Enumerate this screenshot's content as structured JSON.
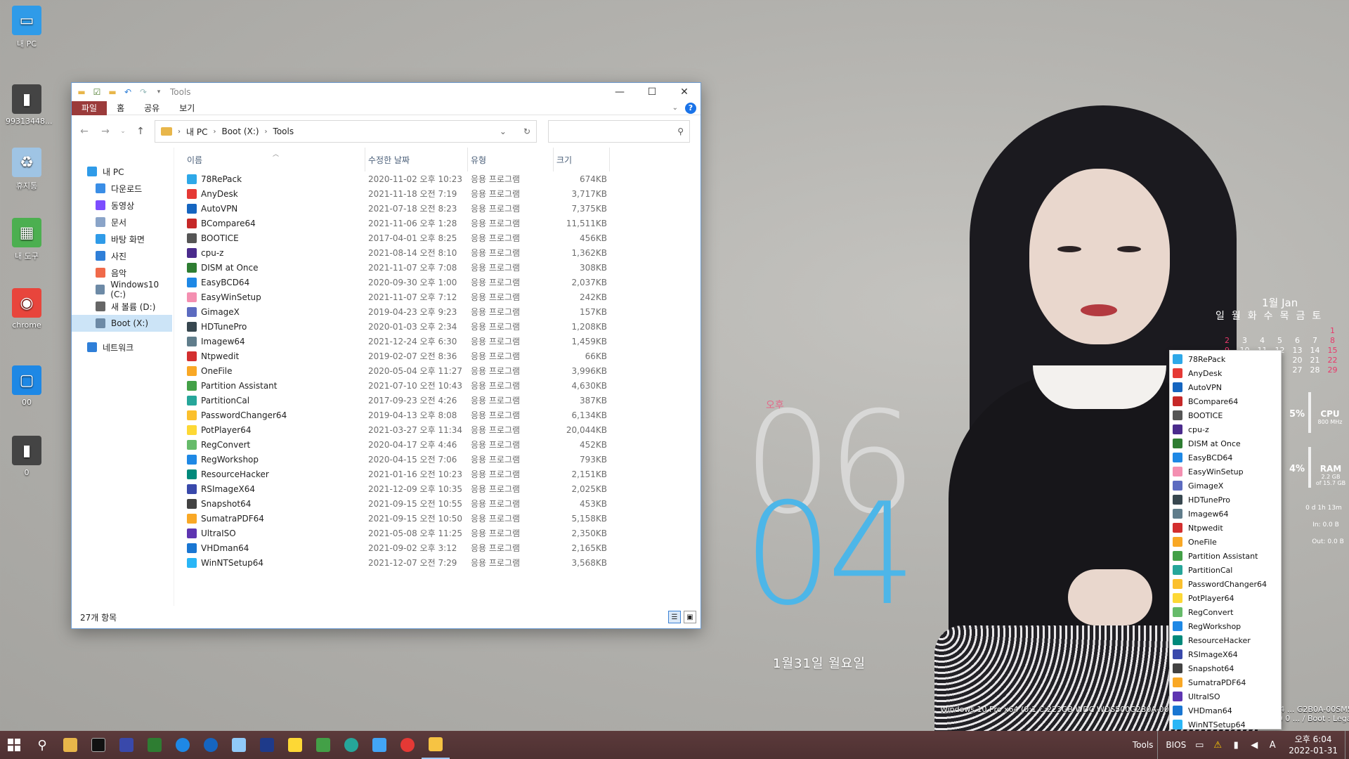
{
  "desktop": {
    "icons": [
      {
        "label": "내 PC",
        "icon": "monitor-icon",
        "color": "#2f9be8"
      },
      {
        "label": "99313448...",
        "icon": "usb-drive-icon",
        "color": "#444444"
      },
      {
        "label": "휴지통",
        "icon": "recycle-bin-icon",
        "color": "#9fc4e4"
      },
      {
        "label": "내 도구",
        "icon": "tools-icon",
        "color": "#4caf50"
      },
      {
        "label": "chrome",
        "icon": "chrome-icon",
        "color": "#e8453c"
      },
      {
        "label": "00",
        "icon": "window-icon",
        "color": "#1e88e5"
      },
      {
        "label": "0",
        "icon": "usb-drive-icon",
        "color": "#444444"
      }
    ]
  },
  "explorer": {
    "title": "Tools",
    "ribbon_tabs": [
      "파일",
      "홈",
      "공유",
      "보기"
    ],
    "address": [
      "내 PC",
      "Boot (X:)",
      "Tools"
    ],
    "search_placeholder": "",
    "nav": [
      {
        "label": "내 PC",
        "level": 0,
        "color": "#2f9be8"
      },
      {
        "label": "다운로드",
        "level": 1,
        "color": "#3a8ee6"
      },
      {
        "label": "동영상",
        "level": 1,
        "color": "#7c4dff"
      },
      {
        "label": "문서",
        "level": 1,
        "color": "#8aa4c8"
      },
      {
        "label": "바탕 화면",
        "level": 1,
        "color": "#2f9be8"
      },
      {
        "label": "사진",
        "level": 1,
        "color": "#2f7fd8"
      },
      {
        "label": "음악",
        "level": 1,
        "color": "#f06a4a"
      },
      {
        "label": "Windows10 (C:)",
        "level": 1,
        "color": "#6d8aa6"
      },
      {
        "label": "새 볼륨 (D:)",
        "level": 1,
        "color": "#666666"
      },
      {
        "label": "Boot (X:)",
        "level": 1,
        "color": "#6d8aa6",
        "selected": true
      },
      {
        "label": "네트워크",
        "level": 0,
        "color": "#2f7fd8"
      }
    ],
    "columns": [
      "이름",
      "수정한 날짜",
      "유형",
      "크기"
    ],
    "files": [
      {
        "name": "78RePack",
        "date": "2020-11-02 오후 10:23",
        "type": "응용 프로그램",
        "size": "674KB",
        "color": "#2ea8e8"
      },
      {
        "name": "AnyDesk",
        "date": "2021-11-18 오전 7:19",
        "type": "응용 프로그램",
        "size": "3,717KB",
        "color": "#e53935"
      },
      {
        "name": "AutoVPN",
        "date": "2021-07-18 오전 8:23",
        "type": "응용 프로그램",
        "size": "7,375KB",
        "color": "#1565c0"
      },
      {
        "name": "BCompare64",
        "date": "2021-11-06 오후 1:28",
        "type": "응용 프로그램",
        "size": "11,511KB",
        "color": "#c62828"
      },
      {
        "name": "BOOTICE",
        "date": "2017-04-01 오후 8:25",
        "type": "응용 프로그램",
        "size": "456KB",
        "color": "#555555"
      },
      {
        "name": "cpu-z",
        "date": "2021-08-14 오전 8:10",
        "type": "응용 프로그램",
        "size": "1,362KB",
        "color": "#4a2b8c"
      },
      {
        "name": "DISM at Once",
        "date": "2021-11-07 오후 7:08",
        "type": "응용 프로그램",
        "size": "308KB",
        "color": "#2e7d32"
      },
      {
        "name": "EasyBCD64",
        "date": "2020-09-30 오후 1:00",
        "type": "응용 프로그램",
        "size": "2,037KB",
        "color": "#1e88e5"
      },
      {
        "name": "EasyWinSetup",
        "date": "2021-11-07 오후 7:12",
        "type": "응용 프로그램",
        "size": "242KB",
        "color": "#f48fb1"
      },
      {
        "name": "GimageX",
        "date": "2019-04-23 오후 9:23",
        "type": "응용 프로그램",
        "size": "157KB",
        "color": "#5c6bc0"
      },
      {
        "name": "HDTunePro",
        "date": "2020-01-03 오후 2:34",
        "type": "응용 프로그램",
        "size": "1,208KB",
        "color": "#37474f"
      },
      {
        "name": "Imagew64",
        "date": "2021-12-24 오후 6:30",
        "type": "응용 프로그램",
        "size": "1,459KB",
        "color": "#607d8b"
      },
      {
        "name": "Ntpwedit",
        "date": "2019-02-07 오전 8:36",
        "type": "응용 프로그램",
        "size": "66KB",
        "color": "#d32f2f"
      },
      {
        "name": "OneFile",
        "date": "2020-05-04 오후 11:27",
        "type": "응용 프로그램",
        "size": "3,996KB",
        "color": "#f9a825"
      },
      {
        "name": "Partition Assistant",
        "date": "2021-07-10 오전 10:43",
        "type": "응용 프로그램",
        "size": "4,630KB",
        "color": "#43a047"
      },
      {
        "name": "PartitionCal",
        "date": "2017-09-23 오전 4:26",
        "type": "응용 프로그램",
        "size": "387KB",
        "color": "#26a69a"
      },
      {
        "name": "PasswordChanger64",
        "date": "2019-04-13 오후 8:08",
        "type": "응용 프로그램",
        "size": "6,134KB",
        "color": "#fbc02d"
      },
      {
        "name": "PotPlayer64",
        "date": "2021-03-27 오후 11:34",
        "type": "응용 프로그램",
        "size": "20,044KB",
        "color": "#fdd835"
      },
      {
        "name": "RegConvert",
        "date": "2020-04-17 오후 4:46",
        "type": "응용 프로그램",
        "size": "452KB",
        "color": "#66bb6a"
      },
      {
        "name": "RegWorkshop",
        "date": "2020-04-15 오전 7:06",
        "type": "응용 프로그램",
        "size": "793KB",
        "color": "#1e88e5"
      },
      {
        "name": "ResourceHacker",
        "date": "2021-01-16 오전 10:23",
        "type": "응용 프로그램",
        "size": "2,151KB",
        "color": "#00897b"
      },
      {
        "name": "RSImageX64",
        "date": "2021-12-09 오후 10:35",
        "type": "응용 프로그램",
        "size": "2,025KB",
        "color": "#3949ab"
      },
      {
        "name": "Snapshot64",
        "date": "2021-09-15 오전 10:55",
        "type": "응용 프로그램",
        "size": "453KB",
        "color": "#424242"
      },
      {
        "name": "SumatraPDF64",
        "date": "2021-09-15 오전 10:50",
        "type": "응용 프로그램",
        "size": "5,158KB",
        "color": "#f9a825"
      },
      {
        "name": "UltraISO",
        "date": "2021-05-08 오후 11:25",
        "type": "응용 프로그램",
        "size": "2,350KB",
        "color": "#5e35b1"
      },
      {
        "name": "VHDman64",
        "date": "2021-09-02 오후 3:12",
        "type": "응용 프로그램",
        "size": "2,165KB",
        "color": "#1976d2"
      },
      {
        "name": "WinNTSetup64",
        "date": "2021-12-07 오전 7:29",
        "type": "응용 프로그램",
        "size": "3,568KB",
        "color": "#29b6f6"
      }
    ],
    "status": "27개 항목"
  },
  "clock": {
    "ampm": "오후",
    "hour": "06",
    "minute": "04",
    "date": "1월31일  월요일"
  },
  "calendar": {
    "title": "1월 Jan",
    "weekdays": [
      "일",
      "월",
      "화",
      "수",
      "목",
      "금",
      "토"
    ],
    "rows": [
      [
        "",
        "",
        "",
        "",
        "",
        "",
        "1"
      ],
      [
        "2",
        "3",
        "4",
        "5",
        "6",
        "7",
        "8"
      ],
      [
        "9",
        "10",
        "11",
        "12",
        "13",
        "14",
        "15"
      ],
      [
        "",
        "",
        "",
        "",
        "20",
        "21",
        "22"
      ],
      [
        "",
        "",
        "",
        "",
        "27",
        "28",
        "29"
      ]
    ]
  },
  "meters": {
    "cpu_pct": "5%",
    "cpu_label": "CPU",
    "cpu_speed": "800 MHz",
    "ram_pct": "4%",
    "ram_label": "RAM",
    "ram_used": "2.2 GB",
    "ram_total": "of 15.7 GB",
    "uptime": "0 d 1h 13m",
    "net_in": "In: 0.0 B",
    "net_out": "Out: 0.0 B"
  },
  "sysinfo": {
    "line1": "Windows 10 Pro x64 (0:1 C:223GB WDC WDS500G2B0A-00SM50) Windows 11 Home x64 ... G2B0A-00SM50)",
    "line2": "CPU : Intel Pentium G32 0 0 ... / Boot : Legacy"
  },
  "taskbar": {
    "tray_label": "Tools",
    "bios_label": "BIOS",
    "ime": "A",
    "time": "오후 6:04",
    "date": "2022-01-31"
  }
}
